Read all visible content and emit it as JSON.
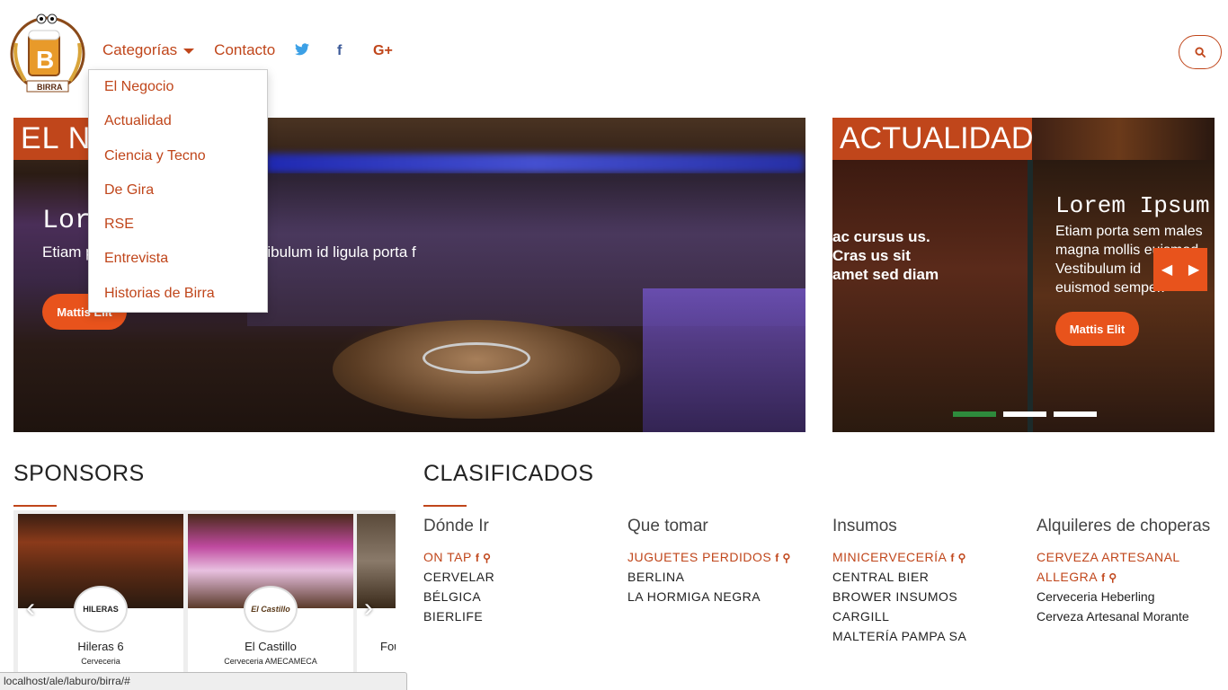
{
  "header": {
    "logo_text": "BIRRA",
    "nav": {
      "categories_label": "Categorías",
      "contact_label": "Contacto"
    },
    "social": [
      "twitter-icon",
      "facebook-icon",
      "google-plus-icon"
    ],
    "search_icon": "search-icon"
  },
  "dropdown": {
    "items": [
      "El Negocio",
      "Actualidad",
      "Ciencia y Tecno",
      "De Gira",
      "RSE",
      "Entrevista",
      "Historias de Birra"
    ]
  },
  "hero_main": {
    "tag": "EL N",
    "title": "Lor            tiam",
    "text": "Etiam p                          gna mollis euismod. Vestibulum id ligula porta f",
    "button": "Mattis Elit"
  },
  "hero_side": {
    "tag": "ACTUALIDAD",
    "left_text": "ac cursus us. Cras us sit amet sed diam",
    "title": "Lorem Ipsum",
    "text_lines": [
      "Etiam porta sem males",
      "magna mollis euismod.",
      "Vestibulum id",
      "euismod semper."
    ],
    "button": "Mattis Elit",
    "prev": "◀",
    "next": "▶"
  },
  "sponsors": {
    "title": "SPONSORS",
    "cards": [
      {
        "name": "Hileras 6",
        "sub": "Cerveceria",
        "logo": "HILERAS"
      },
      {
        "name": "El Castillo",
        "sub": "Cerveceria AMECAMECA",
        "logo": "El Castillo"
      },
      {
        "name": "Fou",
        "sub": "",
        "logo": ""
      }
    ],
    "prev": "‹",
    "next": "›"
  },
  "clasificados": {
    "title": "CLASIFICADOS",
    "columns": [
      {
        "title": "Dónde Ir",
        "items": [
          {
            "text": "ON TAP",
            "hl": true,
            "icons": true
          },
          {
            "text": "CERVELAR"
          },
          {
            "text": "BÉLGICA"
          },
          {
            "text": "BIERLIFE"
          }
        ]
      },
      {
        "title": "Que tomar",
        "items": [
          {
            "text": "JUGUETES PERDIDOS",
            "hl": true,
            "icons": true
          },
          {
            "text": "BERLINA"
          },
          {
            "text": "LA HORMIGA NEGRA"
          }
        ]
      },
      {
        "title": "Insumos",
        "items": [
          {
            "text": "MINICERVECERÍA",
            "hl": true,
            "icons": true
          },
          {
            "text": "CENTRAL BIER"
          },
          {
            "text": "BROWER INSUMOS"
          },
          {
            "text": "CARGILL"
          },
          {
            "text": "MALTERÍA PAMPA SA"
          }
        ]
      },
      {
        "title": "Alquileres de choperas",
        "items": [
          {
            "text": "CERVEZA ARTESANAL",
            "hl": true
          },
          {
            "text": "ALLEGRA",
            "hl": true,
            "icons": true
          },
          {
            "text": "Cerveceria Heberling",
            "plain": true
          },
          {
            "text": "Cerveza Artesanal Morante",
            "plain": true
          }
        ]
      }
    ]
  },
  "status_bar": "localhost/ale/laburo/birra/#",
  "colors": {
    "accent": "#c0461b",
    "button": "#e8531c",
    "dot_active": "#2e8b3c"
  }
}
